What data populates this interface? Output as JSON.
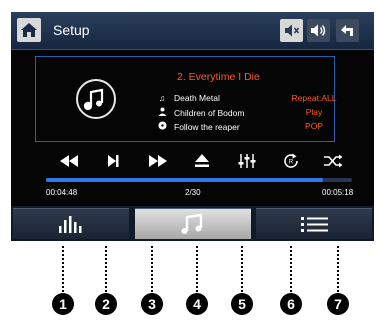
{
  "header": {
    "title": "Setup"
  },
  "now_playing": {
    "track_title": "2. Everytime I Die",
    "genre": "Death Metal",
    "artist": "Children of Bodom",
    "album": "Follow the reaper"
  },
  "status": {
    "repeat": "Repeat:ALL",
    "play_state": "Play",
    "eq_preset": "POP"
  },
  "progress": {
    "elapsed": "00:04:48",
    "track_position": "2/30",
    "total": "00:05:18",
    "fraction": 0.906
  },
  "callouts": [
    "1",
    "2",
    "3",
    "4",
    "5",
    "6",
    "7"
  ],
  "colors": {
    "accent": "#ff5a1f",
    "progress": "#2d7ae6",
    "panel_border": "#2a5fb0"
  }
}
